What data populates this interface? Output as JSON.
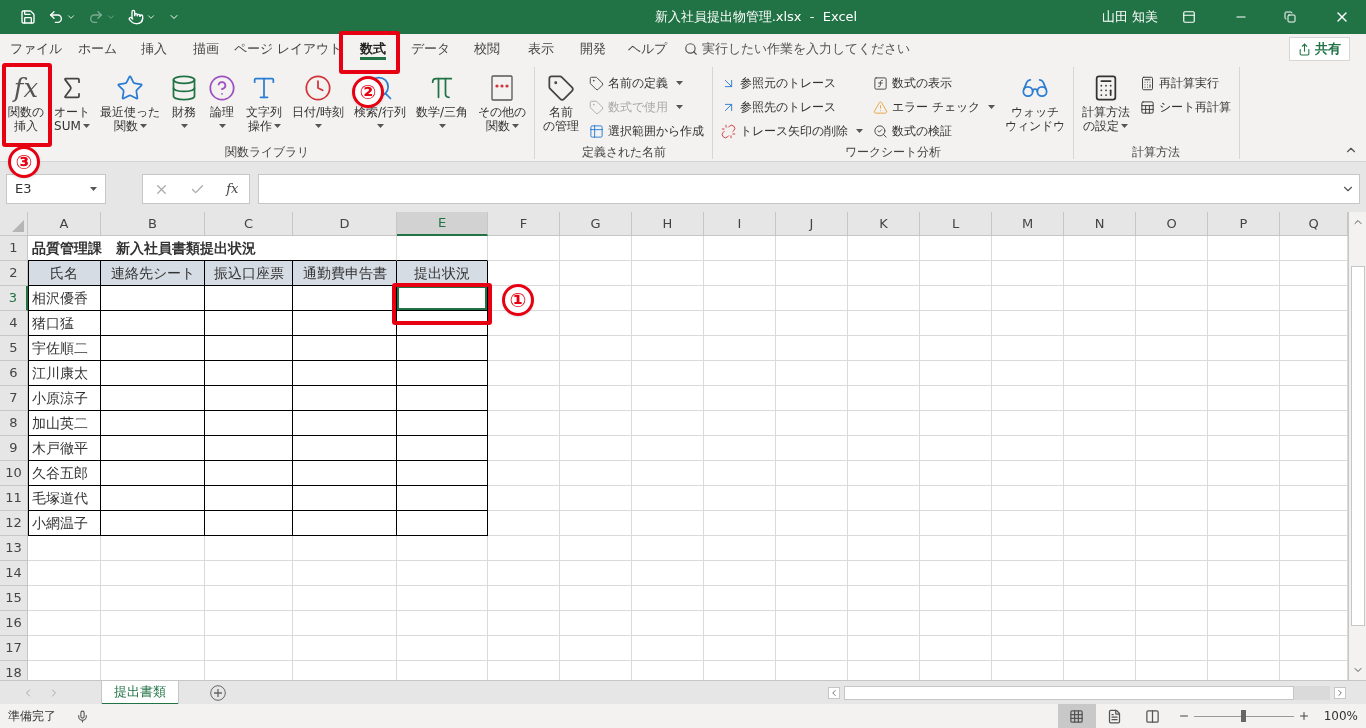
{
  "title_bar": {
    "title": "新入社員提出物管理.xlsx  -  Excel",
    "user": "山田 知美"
  },
  "quick_access": [
    {
      "kind": "save",
      "disabled": false,
      "dropdown": false
    },
    {
      "kind": "undo",
      "disabled": false,
      "dropdown": true
    },
    {
      "kind": "redo",
      "disabled": true,
      "dropdown": true
    },
    {
      "kind": "touch",
      "disabled": false,
      "dropdown": true
    },
    {
      "kind": "customize",
      "disabled": false,
      "dropdown": false
    }
  ],
  "ribbon_tabs": [
    {
      "label": "ファイル",
      "selected": false
    },
    {
      "label": "ホーム",
      "selected": false
    },
    {
      "label": "挿入",
      "selected": false
    },
    {
      "label": "描画",
      "selected": false
    },
    {
      "label": "ページ レイアウト",
      "selected": false
    },
    {
      "label": "数式",
      "selected": true
    },
    {
      "label": "データ",
      "selected": false
    },
    {
      "label": "校閲",
      "selected": false
    },
    {
      "label": "表示",
      "selected": false
    },
    {
      "label": "開発",
      "selected": false
    },
    {
      "label": "ヘルプ",
      "selected": false
    }
  ],
  "tell_me": {
    "placeholder": "実行したい作業を入力してください"
  },
  "share_button": "共有",
  "ribbon_groups": [
    {
      "label": "関数ライブラリ",
      "items": [
        {
          "kind": "large",
          "glyph": "fx",
          "lines": [
            "関数の",
            "挿入"
          ],
          "dropdown": false,
          "disabled": false
        },
        {
          "kind": "large",
          "lines": [
            "オート",
            "SUM"
          ],
          "dropdown": true,
          "disabled": false
        },
        {
          "kind": "large",
          "lines": [
            "最近使った",
            "関数"
          ],
          "dropdown": true,
          "disabled": false
        },
        {
          "kind": "large",
          "lines": [
            "財務"
          ],
          "dropdown": true,
          "disabled": false
        },
        {
          "kind": "large",
          "lines": [
            "論理"
          ],
          "dropdown": true,
          "disabled": false
        },
        {
          "kind": "large",
          "lines": [
            "文字列",
            "操作"
          ],
          "dropdown": true,
          "disabled": false
        },
        {
          "kind": "large",
          "lines": [
            "日付/時刻"
          ],
          "dropdown": true,
          "disabled": false
        },
        {
          "kind": "large",
          "lines": [
            "検索/行列"
          ],
          "dropdown": true,
          "disabled": false
        },
        {
          "kind": "large",
          "lines": [
            "数学/三角"
          ],
          "dropdown": true,
          "disabled": false
        },
        {
          "kind": "large",
          "lines": [
            "その他の",
            "関数"
          ],
          "dropdown": true,
          "disabled": false
        }
      ]
    },
    {
      "label": "定義された名前",
      "items": [
        {
          "kind": "large",
          "lines": [
            "名前",
            "の管理"
          ],
          "dropdown": false,
          "disabled": false
        },
        {
          "kind": "small",
          "lines": [
            "名前の定義"
          ],
          "dropdown": true,
          "disabled": false
        },
        {
          "kind": "small",
          "lines": [
            "数式で使用"
          ],
          "dropdown": true,
          "disabled": true
        },
        {
          "kind": "small",
          "lines": [
            "選択範囲から作成"
          ],
          "dropdown": false,
          "disabled": false
        }
      ]
    },
    {
      "label": "ワークシート分析",
      "items": [
        {
          "kind": "small",
          "lines": [
            "参照元のトレース"
          ],
          "dropdown": false,
          "disabled": false
        },
        {
          "kind": "small",
          "lines": [
            "参照先のトレース"
          ],
          "dropdown": false,
          "disabled": false
        },
        {
          "kind": "small",
          "lines": [
            "トレース矢印の削除"
          ],
          "dropdown": true,
          "disabled": false
        },
        {
          "kind": "small",
          "lines": [
            "数式の表示"
          ],
          "dropdown": false,
          "disabled": false
        },
        {
          "kind": "small",
          "lines": [
            "エラー チェック"
          ],
          "dropdown": true,
          "disabled": false
        },
        {
          "kind": "small",
          "lines": [
            "数式の検証"
          ],
          "dropdown": false,
          "disabled": false
        },
        {
          "kind": "large",
          "lines": [
            "ウォッチ",
            "ウィンドウ"
          ],
          "dropdown": false,
          "disabled": false
        }
      ]
    },
    {
      "label": "計算方法",
      "items": [
        {
          "kind": "large",
          "lines": [
            "計算方法",
            "の設定"
          ],
          "dropdown": true,
          "disabled": false
        },
        {
          "kind": "small",
          "lines": [
            "再計算実行"
          ],
          "dropdown": false,
          "disabled": false
        },
        {
          "kind": "small",
          "lines": [
            "シート再計算"
          ],
          "dropdown": false,
          "disabled": false
        }
      ]
    }
  ],
  "formula_bar": {
    "name_box": "E3",
    "fx_glyph": "fx"
  },
  "sheet": {
    "columns": [
      {
        "label": "A",
        "selected": false
      },
      {
        "label": "B",
        "selected": false
      },
      {
        "label": "C",
        "selected": false
      },
      {
        "label": "D",
        "selected": false
      },
      {
        "label": "E",
        "selected": true
      },
      {
        "label": "F",
        "selected": false
      },
      {
        "label": "G",
        "selected": false
      },
      {
        "label": "H",
        "selected": false
      },
      {
        "label": "I",
        "selected": false
      },
      {
        "label": "J",
        "selected": false
      },
      {
        "label": "K",
        "selected": false
      },
      {
        "label": "L",
        "selected": false
      },
      {
        "label": "M",
        "selected": false
      },
      {
        "label": "N",
        "selected": false
      },
      {
        "label": "O",
        "selected": false
      },
      {
        "label": "P",
        "selected": false
      },
      {
        "label": "Q",
        "selected": false
      }
    ],
    "rows": [
      {
        "label": "1",
        "selected": false
      },
      {
        "label": "2",
        "selected": false
      },
      {
        "label": "3",
        "selected": true
      },
      {
        "label": "4",
        "selected": false
      },
      {
        "label": "5",
        "selected": false
      },
      {
        "label": "6",
        "selected": false
      },
      {
        "label": "7",
        "selected": false
      },
      {
        "label": "8",
        "selected": false
      },
      {
        "label": "9",
        "selected": false
      },
      {
        "label": "10",
        "selected": false
      },
      {
        "label": "11",
        "selected": false
      },
      {
        "label": "12",
        "selected": false
      },
      {
        "label": "13",
        "selected": false
      },
      {
        "label": "14",
        "selected": false
      },
      {
        "label": "15",
        "selected": false
      },
      {
        "label": "16",
        "selected": false
      },
      {
        "label": "17",
        "selected": false
      },
      {
        "label": "18",
        "selected": false
      }
    ],
    "title": "品質管理課　新入社員書類提出状況",
    "headers": [
      "氏名",
      "連絡先シート",
      "振込口座票",
      "通勤費申告書",
      "提出状況"
    ],
    "names": [
      "相沢優香",
      "猪口猛",
      "宇佐順二",
      "江川康太",
      "小原涼子",
      "加山英二",
      "木戸徹平",
      "久谷五郎",
      "毛塚道代",
      "小網温子"
    ]
  },
  "sheet_tabs": [
    {
      "label": "提出書類",
      "selected": true
    }
  ],
  "status_bar": {
    "status": "準備完了",
    "views": [
      {
        "kind": "normal",
        "selected": true
      },
      {
        "kind": "page_layout",
        "selected": false
      },
      {
        "kind": "page_break",
        "selected": false
      }
    ],
    "zoom_slider": {
      "level": 0.5
    },
    "zoom": "100%"
  },
  "annotations": [
    {
      "label": "①",
      "kind": "cell"
    },
    {
      "label": "②",
      "kind": "tab"
    },
    {
      "label": "③",
      "kind": "button"
    }
  ]
}
